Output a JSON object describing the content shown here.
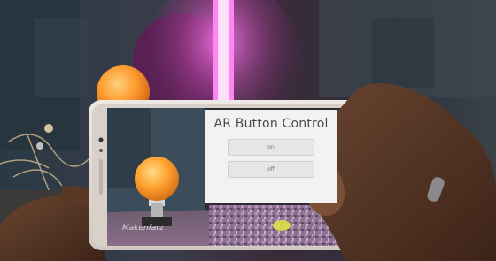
{
  "ar_app": {
    "title": "AR Button Control",
    "buttons": [
      {
        "label": "on"
      },
      {
        "label": "off"
      }
    ],
    "footer": "",
    "watermark": "Makenfarz"
  },
  "colors": {
    "panel_bg": "#f2f2f2",
    "bulb_orange": "#ff9a2e",
    "light_tube_pink": "#ff6fe6"
  }
}
